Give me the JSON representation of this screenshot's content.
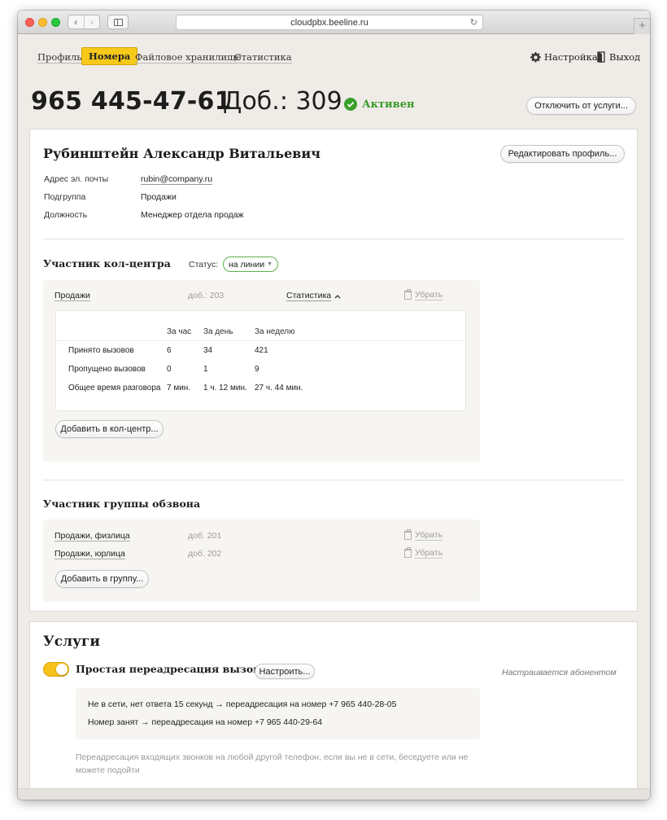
{
  "browser": {
    "url": "cloudpbx.beeline.ru",
    "back_glyph": "‹",
    "forward_glyph": "›",
    "reload_glyph": "↻",
    "new_tab_glyph": "+"
  },
  "nav": {
    "items": [
      {
        "label": "Профиль"
      },
      {
        "label": "Номера"
      },
      {
        "label": "Файловое хранилище"
      },
      {
        "label": "Статистика"
      }
    ],
    "active_index": 1,
    "settings_label": "Настройка",
    "logout_label": "Выход"
  },
  "header": {
    "phone": "965 445-47-61",
    "extension": "Доб.: 309",
    "status": "Активен",
    "disconnect_label": "Отключить от услуги..."
  },
  "profile": {
    "name": "Рубинштейн Александр Витальевич",
    "edit_label": "Редактировать профиль...",
    "fields": [
      {
        "label": "Адрес эл. почты",
        "value": "rubin@company.ru"
      },
      {
        "label": "Подгруппа",
        "value": "Продажи"
      },
      {
        "label": "Должность",
        "value": "Менеджер отдела продаж"
      }
    ]
  },
  "callcenter": {
    "title": "Участник кол-центра",
    "status_label": "Статус:",
    "status_value": "на линии",
    "row": {
      "name": "Продажи",
      "ext": "доб.: 203",
      "stats_link": "Статистика",
      "remove_label": "Убрать"
    },
    "stats": {
      "columns": [
        "За час",
        "За день",
        "За неделю"
      ],
      "rows": [
        {
          "label": "Принято вызовов",
          "values": [
            "6",
            "34",
            "421"
          ]
        },
        {
          "label": "Пропущено вызовов",
          "values": [
            "0",
            "1",
            "9"
          ]
        },
        {
          "label": "Общее время разговора",
          "values": [
            "7 мин.",
            "1 ч. 12 мин.",
            "27 ч. 44 мин."
          ]
        }
      ]
    },
    "add_label": "Добавить в кол-центр..."
  },
  "dialgroup": {
    "title": "Участник группы обзвона",
    "rows": [
      {
        "name": "Продажи, физлица",
        "ext": "доб. 201",
        "remove_label": "Убрать"
      },
      {
        "name": "Продажи, юрлица",
        "ext": "доб. 202",
        "remove_label": "Убрать"
      }
    ],
    "add_label": "Добавить в группу..."
  },
  "services": {
    "title": "Услуги",
    "service_name": "Простая переадресация вызовов",
    "configure_label": "Настроить...",
    "note": "Настраивается абонентом",
    "rules": [
      "Не в сети, нет ответа 15 секунд → переадресация на номер +7 965 440-28-05",
      "Номер занят → переадресация на номер +7 965 440-29-64"
    ],
    "description": "Переадресация входящих звонков на любой другой телефон, если вы не в сети, беседуете или не можете подойти"
  },
  "colors": {
    "accent_yellow": "#f7c91b",
    "active_green": "#3a9b2a"
  }
}
